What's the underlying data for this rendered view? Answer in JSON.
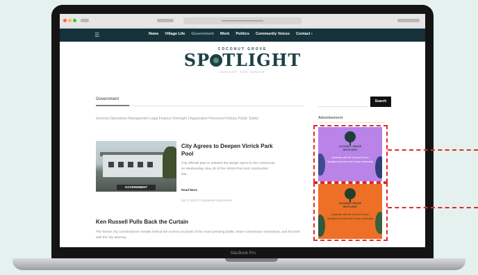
{
  "device": {
    "model_label": "MacBook Pro"
  },
  "site": {
    "nav": {
      "menu_icon": "hamburger-icon",
      "items": [
        {
          "label": "News",
          "active": false
        },
        {
          "label": "Village Life",
          "active": false
        },
        {
          "label": "Government",
          "active": true
        },
        {
          "label": "Work",
          "active": false
        },
        {
          "label": "Politics",
          "active": false
        },
        {
          "label": "Community Voices",
          "active": false
        },
        {
          "label": "Contact ›",
          "active": false
        }
      ]
    },
    "logo": {
      "sub": "COCONUT GROVE",
      "main_before": "SP",
      "main_after": "TLIGHT",
      "tagline": "INSIGHT THE GROVE"
    }
  },
  "main": {
    "heading": "Government",
    "categories": "Services  Operations Management  Legal  Finance  Oversight  Organization  Personnel  Policies  Public Safety",
    "featured": {
      "image_label": "GOVERNMENT",
      "title": "City Agrees to Deepen Virrick Park Pool",
      "excerpt": "City officials plan to unleash the design specs to the community on Wednesday, May 25 of the Virrick Pool and construction site.",
      "read_more": "Read More",
      "meta": "Jun 3, 2022  |  0 comments  Government"
    },
    "second": {
      "title": "Ken Russell Pulls Back the Curtain",
      "excerpt": "The former city commissioner reveals behind the scenes accounts of the more pressing battle, future commission resolutions, and his beef with the city attorney."
    }
  },
  "sidebar": {
    "search": {
      "placeholder": "",
      "button": "Search"
    },
    "ad_heading": "Advertisement",
    "ads": [
      {
        "logo_text": "COCONUT GROVE\nSPOTLIGHT",
        "body": "Advertise with the Coconut Grove Spotlight and reach the Grove community",
        "background": "#b983e8"
      },
      {
        "logo_text": "COCONUT GROVE\nSPOTLIGHT",
        "body": "Advertise with the Coconut Grove Spotlight and reach the Grove community",
        "background": "#ee6f26"
      }
    ]
  },
  "colors": {
    "nav_bg": "#16323b",
    "callout": "#e02a24",
    "page_bg": "#e4f1ee"
  }
}
